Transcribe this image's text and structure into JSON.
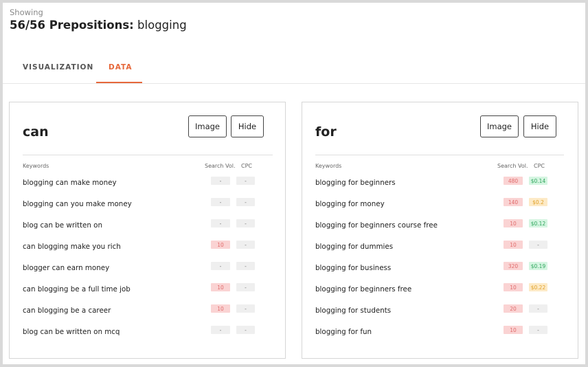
{
  "header": {
    "showing_label": "Showing",
    "count_label": "56/56 Prepositions:",
    "keyword": "blogging"
  },
  "tabs": [
    {
      "label": "VISUALIZATION",
      "active": false
    },
    {
      "label": "DATA",
      "active": true
    }
  ],
  "colors": {
    "accent": "#e6673a",
    "volume_badge": "#fad3d3",
    "cpc_low": "#d5f5e1",
    "cpc_mid": "#fdeac6",
    "empty_badge": "#efefef"
  },
  "cards": [
    {
      "title": "can",
      "image_button": "Image",
      "hide_button": "Hide",
      "col_keywords": "Keywords",
      "col_volume": "Search Vol.",
      "col_cpc": "CPC",
      "rows": [
        {
          "keyword": "blogging can make money",
          "volume": "-",
          "cpc": "-"
        },
        {
          "keyword": "blogging can you make money",
          "volume": "-",
          "cpc": "-"
        },
        {
          "keyword": "blog can be written on",
          "volume": "-",
          "cpc": "-"
        },
        {
          "keyword": "can blogging make you rich",
          "volume": "10",
          "cpc": "-"
        },
        {
          "keyword": "blogger can earn money",
          "volume": "-",
          "cpc": "-"
        },
        {
          "keyword": "can blogging be a full time job",
          "volume": "10",
          "cpc": "-"
        },
        {
          "keyword": "can blogging be a career",
          "volume": "10",
          "cpc": "-"
        },
        {
          "keyword": "blog can be written on mcq",
          "volume": "-",
          "cpc": "-"
        }
      ]
    },
    {
      "title": "for",
      "image_button": "Image",
      "hide_button": "Hide",
      "col_keywords": "Keywords",
      "col_volume": "Search Vol.",
      "col_cpc": "CPC",
      "rows": [
        {
          "keyword": "blogging for beginners",
          "volume": "480",
          "cpc": "$0.14"
        },
        {
          "keyword": "blogging for money",
          "volume": "140",
          "cpc": "$0.2"
        },
        {
          "keyword": "blogging for beginners course free",
          "volume": "10",
          "cpc": "$0.12"
        },
        {
          "keyword": "blogging for dummies",
          "volume": "10",
          "cpc": "-"
        },
        {
          "keyword": "blogging for business",
          "volume": "320",
          "cpc": "$0.19"
        },
        {
          "keyword": "blogging for beginners free",
          "volume": "10",
          "cpc": "$0.22"
        },
        {
          "keyword": "blogging for students",
          "volume": "20",
          "cpc": "-"
        },
        {
          "keyword": "blogging for fun",
          "volume": "10",
          "cpc": "-"
        }
      ]
    }
  ]
}
